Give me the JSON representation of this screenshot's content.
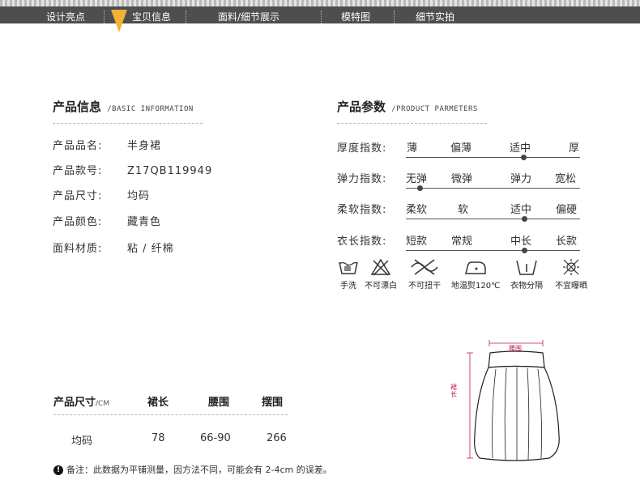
{
  "nav": {
    "items": [
      "设计亮点",
      "宝贝信息",
      "面料/细节展示",
      "模特图",
      "细节实拍"
    ],
    "active_index": 1,
    "marker_color": "#f2b233"
  },
  "basic_info": {
    "title": "产品信息",
    "subtitle": "BASIC INFORMATION",
    "rows": [
      {
        "label": "产品品名:",
        "value": "半身裙"
      },
      {
        "label": "产品款号:",
        "value": "Z17QB119949"
      },
      {
        "label": "产品尺寸:",
        "value": "均码"
      },
      {
        "label": "产品颜色:",
        "value": "藏青色"
      },
      {
        "label": "面料材质:",
        "value": "粘 / 纤棉"
      }
    ]
  },
  "params": {
    "title": "产品参数",
    "subtitle": "PRODUCT PARMETERS",
    "rows": [
      {
        "label": "厚度指数:",
        "options": [
          "薄",
          "偏薄",
          "适中",
          "厚"
        ],
        "selected": 2
      },
      {
        "label": "弹力指数:",
        "options": [
          "无弹",
          "微弹",
          "弹力",
          "宽松"
        ],
        "selected": 0
      },
      {
        "label": "柔软指数:",
        "options": [
          "柔软",
          "软",
          "适中",
          "偏硬"
        ],
        "selected": 2
      },
      {
        "label": "衣长指数:",
        "options": [
          "短款",
          "常规",
          "中长",
          "长款"
        ],
        "selected": 2
      }
    ]
  },
  "care": [
    {
      "icon": "hand-wash-icon",
      "label": "手洗"
    },
    {
      "icon": "no-bleach-icon",
      "label": "不可漂白"
    },
    {
      "icon": "no-wring-icon",
      "label": "不可扭干"
    },
    {
      "icon": "low-iron-icon",
      "label": "地温熨120℃"
    },
    {
      "icon": "separate-wash-icon",
      "label": "衣物分隔"
    },
    {
      "icon": "no-sun-icon",
      "label": "不宜曝晒"
    }
  ],
  "size_table": {
    "headers": [
      "产品尺寸",
      "裙长",
      "腰围",
      "摆围"
    ],
    "unit": "/CM",
    "rows": [
      [
        "均码",
        "78",
        "66-90",
        "266"
      ]
    ]
  },
  "note": {
    "icon": "exclamation-icon",
    "text": "备注：此数据为平铺测量，因方法不同，可能会有 2-4cm 的误差。"
  },
  "diagram": {
    "waist_label": "腰围",
    "length_label": "裙长",
    "label_color": "#c2185b"
  }
}
